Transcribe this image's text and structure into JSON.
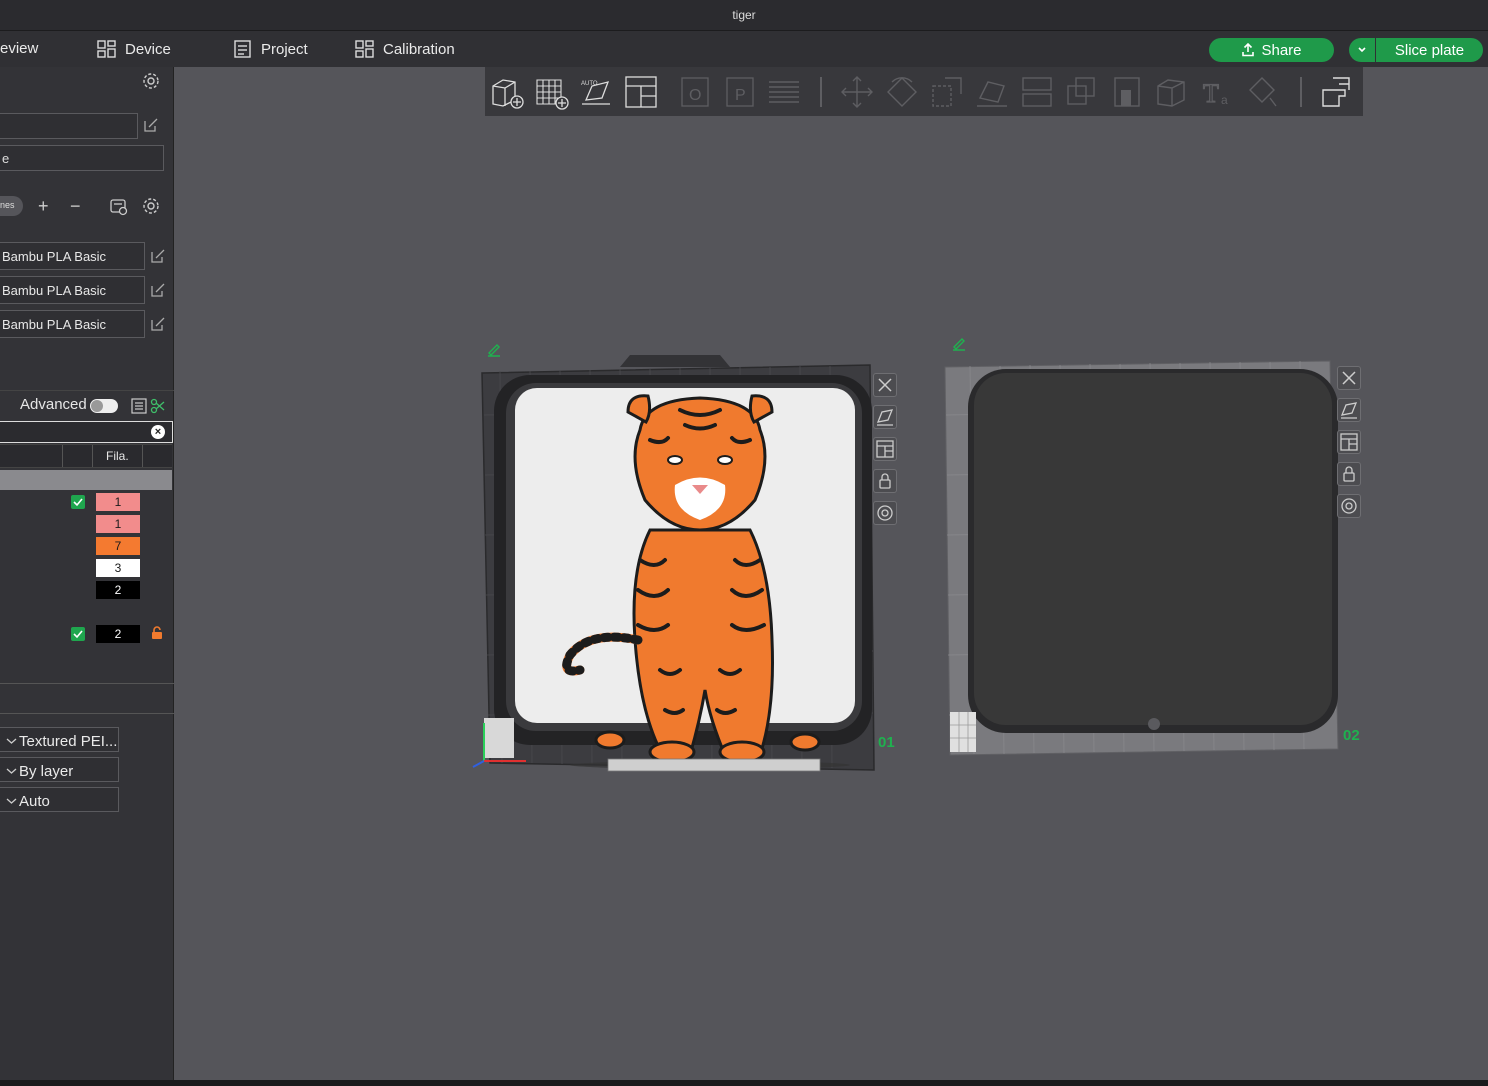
{
  "window": {
    "title": "tiger"
  },
  "menubar": {
    "preview": "eview",
    "device": "Device",
    "project": "Project",
    "calibration": "Calibration",
    "share": "Share",
    "slice_plate": "Slice plate"
  },
  "sidebar": {
    "printer_value": "e",
    "pill_text": "nes",
    "filaments": [
      {
        "label": "Bambu PLA Basic"
      },
      {
        "label": "Bambu PLA Basic"
      },
      {
        "label": "Bambu PLA Basic"
      }
    ],
    "advanced_label": "Advanced",
    "advanced_on": false,
    "table_header_fila": "Fila.",
    "objects": [
      {
        "fila": "1",
        "color": "#f28c8c",
        "text_color": "#1a1a1a",
        "checked": true
      },
      {
        "fila": "1",
        "color": "#f28c8c",
        "text_color": "#1a1a1a",
        "checked": false
      },
      {
        "fila": "7",
        "color": "#f47a30",
        "text_color": "#1a1a1a",
        "checked": false
      },
      {
        "fila": "3",
        "color": "#ffffff",
        "text_color": "#1a1a1a",
        "checked": false
      },
      {
        "fila": "2",
        "color": "#000000",
        "text_color": "#ffffff",
        "checked": false
      },
      {
        "fila": "2",
        "color": "#000000",
        "text_color": "#ffffff",
        "checked": true,
        "locked": true
      }
    ],
    "plate_type": "Textured PEI...",
    "sequence": "By layer",
    "auto_label": "Auto"
  },
  "plates": {
    "plate1_label": "01",
    "plate2_label": "02"
  },
  "colors": {
    "accent_green": "#1f9a4a",
    "tiger_orange": "#f07a2e",
    "background": "#55555a"
  }
}
